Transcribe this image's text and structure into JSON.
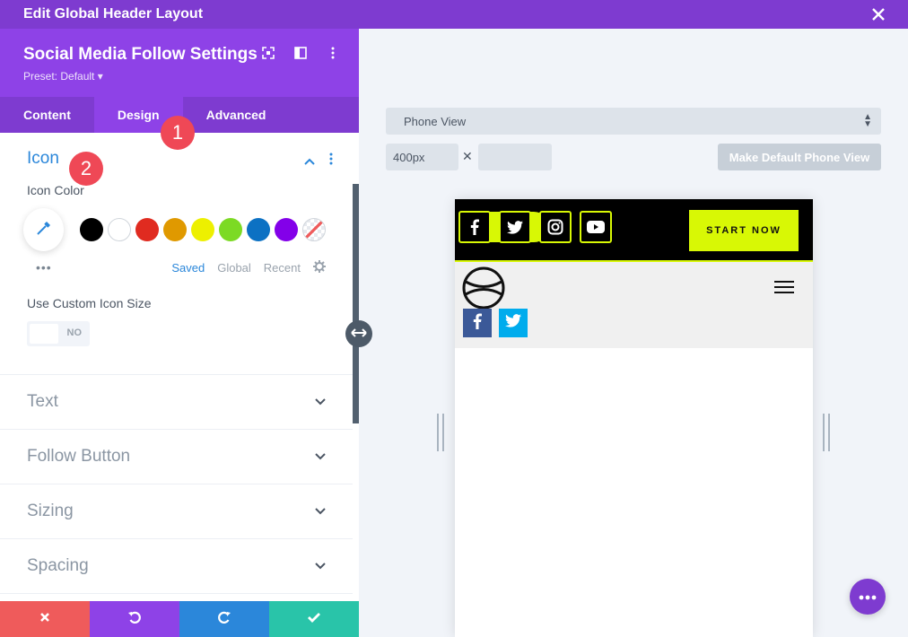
{
  "window": {
    "title": "Edit Global Header Layout"
  },
  "module": {
    "title": "Social Media Follow Settings",
    "preset": "Preset: Default ▾"
  },
  "tabs": [
    {
      "label": "Content",
      "active": false
    },
    {
      "label": "Design",
      "active": true
    },
    {
      "label": "Advanced",
      "active": false
    }
  ],
  "markers": {
    "tab": "1",
    "section": "2"
  },
  "icon_section": {
    "title": "Icon",
    "color_label": "Icon Color",
    "swatches": [
      "#000000",
      "#ffffff",
      "#e02b20",
      "#e09900",
      "#edf000",
      "#7cda24",
      "#0c71c3",
      "#8300e9"
    ],
    "palette_tabs": [
      "Saved",
      "Global",
      "Recent"
    ],
    "custom_size_label": "Use Custom Icon Size",
    "toggle_value": "NO"
  },
  "sections": [
    "Text",
    "Follow Button",
    "Sizing",
    "Spacing"
  ],
  "footer": {
    "colors": {
      "cancel": "#ef5b5b",
      "undo": "#8e42e7",
      "redo": "#2b87da",
      "save": "#29c4a9"
    }
  },
  "preview": {
    "view_select": "Phone View",
    "width_value": "400px",
    "times": "✕",
    "make_default": "Make Default Phone View",
    "start_button": "START NOW",
    "top_icons": [
      "facebook-icon",
      "twitter-icon",
      "instagram-icon",
      "youtube-icon"
    ],
    "social_buttons": [
      {
        "icon": "facebook-icon",
        "color": "#3b5998"
      },
      {
        "icon": "twitter-icon",
        "color": "#00aced"
      }
    ]
  },
  "colors": {
    "accent_purple": "#7e3bd0",
    "accent_lime": "#d8f805",
    "accent_blue": "#2b87da"
  }
}
